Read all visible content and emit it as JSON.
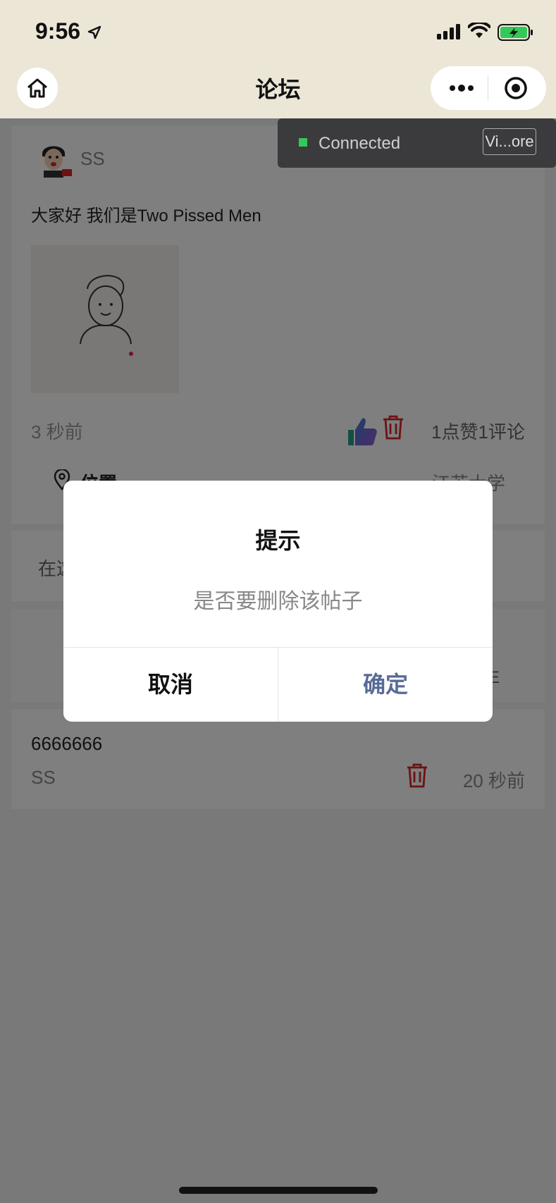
{
  "status_bar": {
    "time": "9:56"
  },
  "nav": {
    "title": "论坛"
  },
  "post": {
    "author": "SS",
    "text": "大家好 我们是Two Pissed Men",
    "time": "3 秒前",
    "stats": "1点赞1评论",
    "location_label": "位置",
    "location_value": "江苏大学"
  },
  "comment_box": {
    "placeholder": "在这"
  },
  "card3": {
    "right_text": "E"
  },
  "comment": {
    "text": "6666666",
    "author": "SS",
    "time": "20 秒前"
  },
  "toast": {
    "text": "Connected",
    "button": "Vi...ore"
  },
  "dialog": {
    "title": "提示",
    "message": "是否要删除该帖子",
    "cancel": "取消",
    "confirm": "确定"
  },
  "colors": {
    "header_bg": "#ece6d6",
    "dialog_confirm": "#576b95",
    "delete_icon": "#d9252a",
    "toast_dot": "#34c759"
  }
}
